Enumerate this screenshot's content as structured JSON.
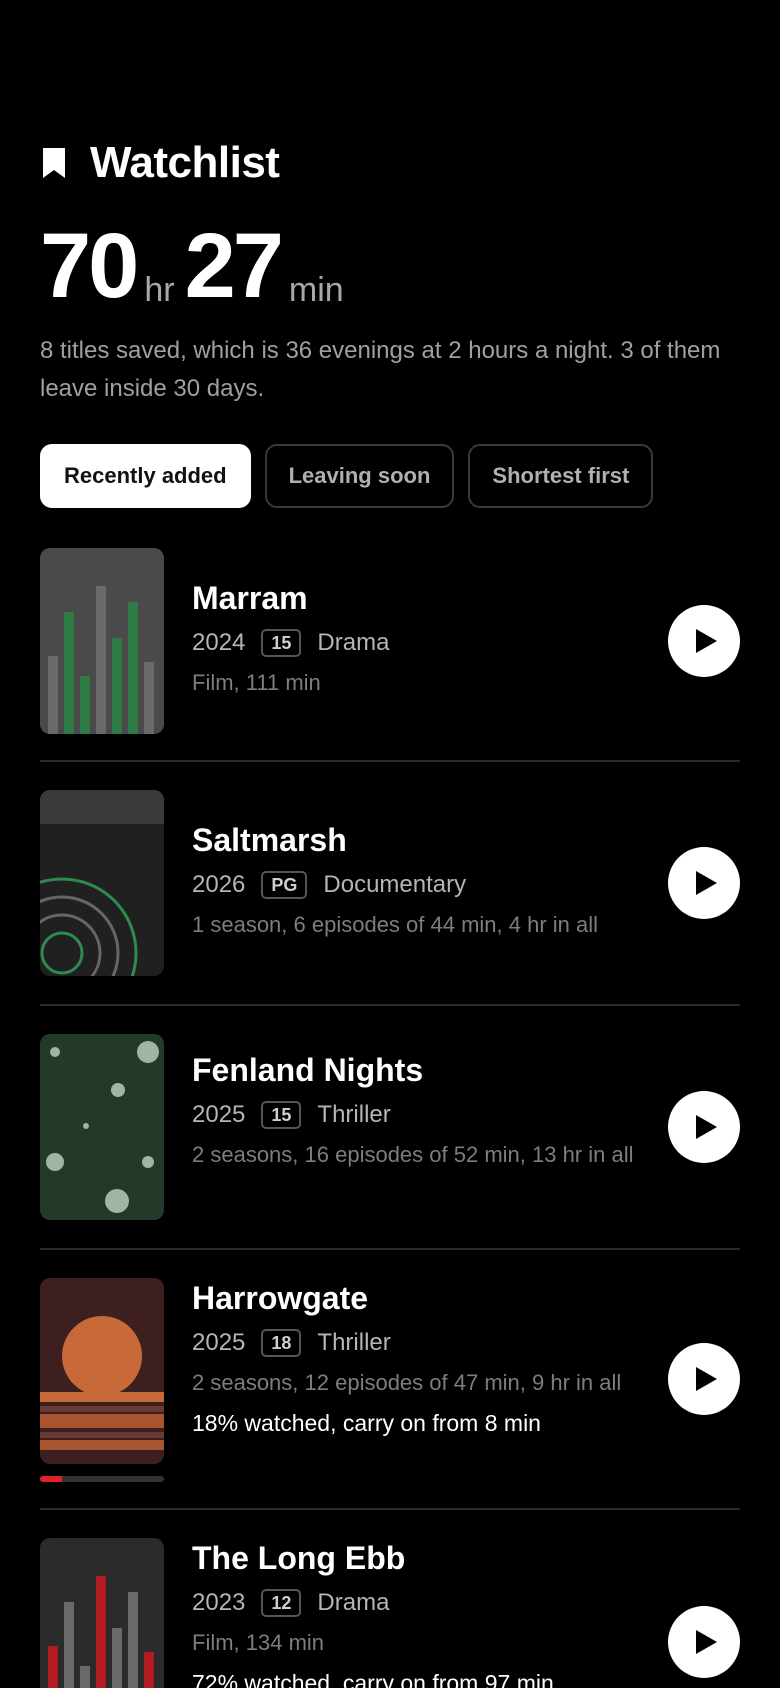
{
  "header": {
    "icon": "bookmark-icon",
    "title": "Watchlist"
  },
  "runtime": {
    "hours": "70",
    "hours_unit": "hr",
    "minutes": "27",
    "minutes_unit": "min"
  },
  "summary": "8 titles saved, which is 36 evenings at 2 hours a night. 3 of them leave inside 30 days.",
  "filters": [
    {
      "label": "Recently added",
      "active": true
    },
    {
      "label": "Leaving soon",
      "active": false
    },
    {
      "label": "Shortest first",
      "active": false
    }
  ],
  "items": [
    {
      "title": "Marram",
      "year": "2024",
      "rating": "15",
      "genre": "Drama",
      "detail": "Film, 111 min",
      "progress_text": "",
      "progress": null
    },
    {
      "title": "Saltmarsh",
      "year": "2026",
      "rating": "PG",
      "genre": "Documentary",
      "detail": "1 season, 6 episodes of 44 min, 4 hr in all",
      "progress_text": "",
      "progress": null
    },
    {
      "title": "Fenland Nights",
      "year": "2025",
      "rating": "15",
      "genre": "Thriller",
      "detail": "2 seasons, 16 episodes of 52 min, 13 hr in all",
      "progress_text": "",
      "progress": null
    },
    {
      "title": "Harrowgate",
      "year": "2025",
      "rating": "18",
      "genre": "Thriller",
      "detail": "2 seasons, 12 episodes of 47 min, 9 hr in all",
      "progress_text": "18% watched, carry on from 8 min",
      "progress": 0.18
    },
    {
      "title": "The Long Ebb",
      "year": "2023",
      "rating": "12",
      "genre": "Drama",
      "detail": "Film, 134 min",
      "progress_text": "72% watched, carry on from 97 min",
      "progress": 0.72
    }
  ],
  "play_icon": "play-icon",
  "colors": {
    "background": "#000000",
    "accent_progress": "#e0202a",
    "chip_active_bg": "#ffffff"
  }
}
